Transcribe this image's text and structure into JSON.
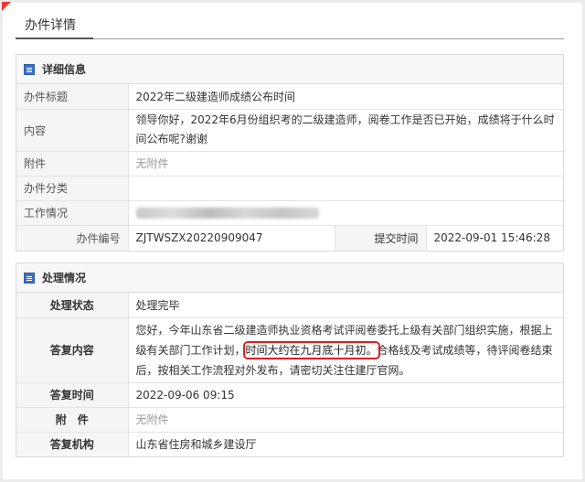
{
  "page": {
    "title": "办件详情"
  },
  "detail": {
    "section_title": "详细信息",
    "rows": {
      "subject_label": "办件标题",
      "subject_value": "2022年二级建造师成绩公布时间",
      "content_label": "内容",
      "content_value": "领导你好，2022年6月份组织考的二级建造师，阅卷工作是否已开始，成绩将于什么时间公布呢?谢谢",
      "attachment_label": "附件",
      "attachment_value": "无附件",
      "category_label": "办件分类",
      "category_value": "",
      "work_label": "工作情况",
      "number_label": "办件编号",
      "number_value": "ZJTWSZX20220909047",
      "submit_label": "提交时间",
      "submit_value": "2022-09-01 15:46:28"
    }
  },
  "handling": {
    "section_title": "处理情况",
    "rows": {
      "status_label": "处理状态",
      "status_value": "处理完毕",
      "reply_label": "答复内容",
      "reply_before": "您好，今年山东省二级建造师执业资格考试评阅卷委托上级有关部门组织实施，根据上级有关部门工作计划，",
      "reply_highlight": "时间大约在九月底十月初。",
      "reply_after": "合格线及考试成绩等，待评阅卷结束后，按相关工作流程对外发布，请密切关注住建厅官网。",
      "reply_time_label": "答复时间",
      "reply_time_value": "2022-09-06 09:15",
      "attach_label": "附　件",
      "attach_value": "无附件",
      "org_label": "答复机构",
      "org_value": "山东省住房和城乡建设厅"
    }
  },
  "colors": {
    "highlight_border": "#e02020",
    "section_icon": "#3a6fc4"
  }
}
